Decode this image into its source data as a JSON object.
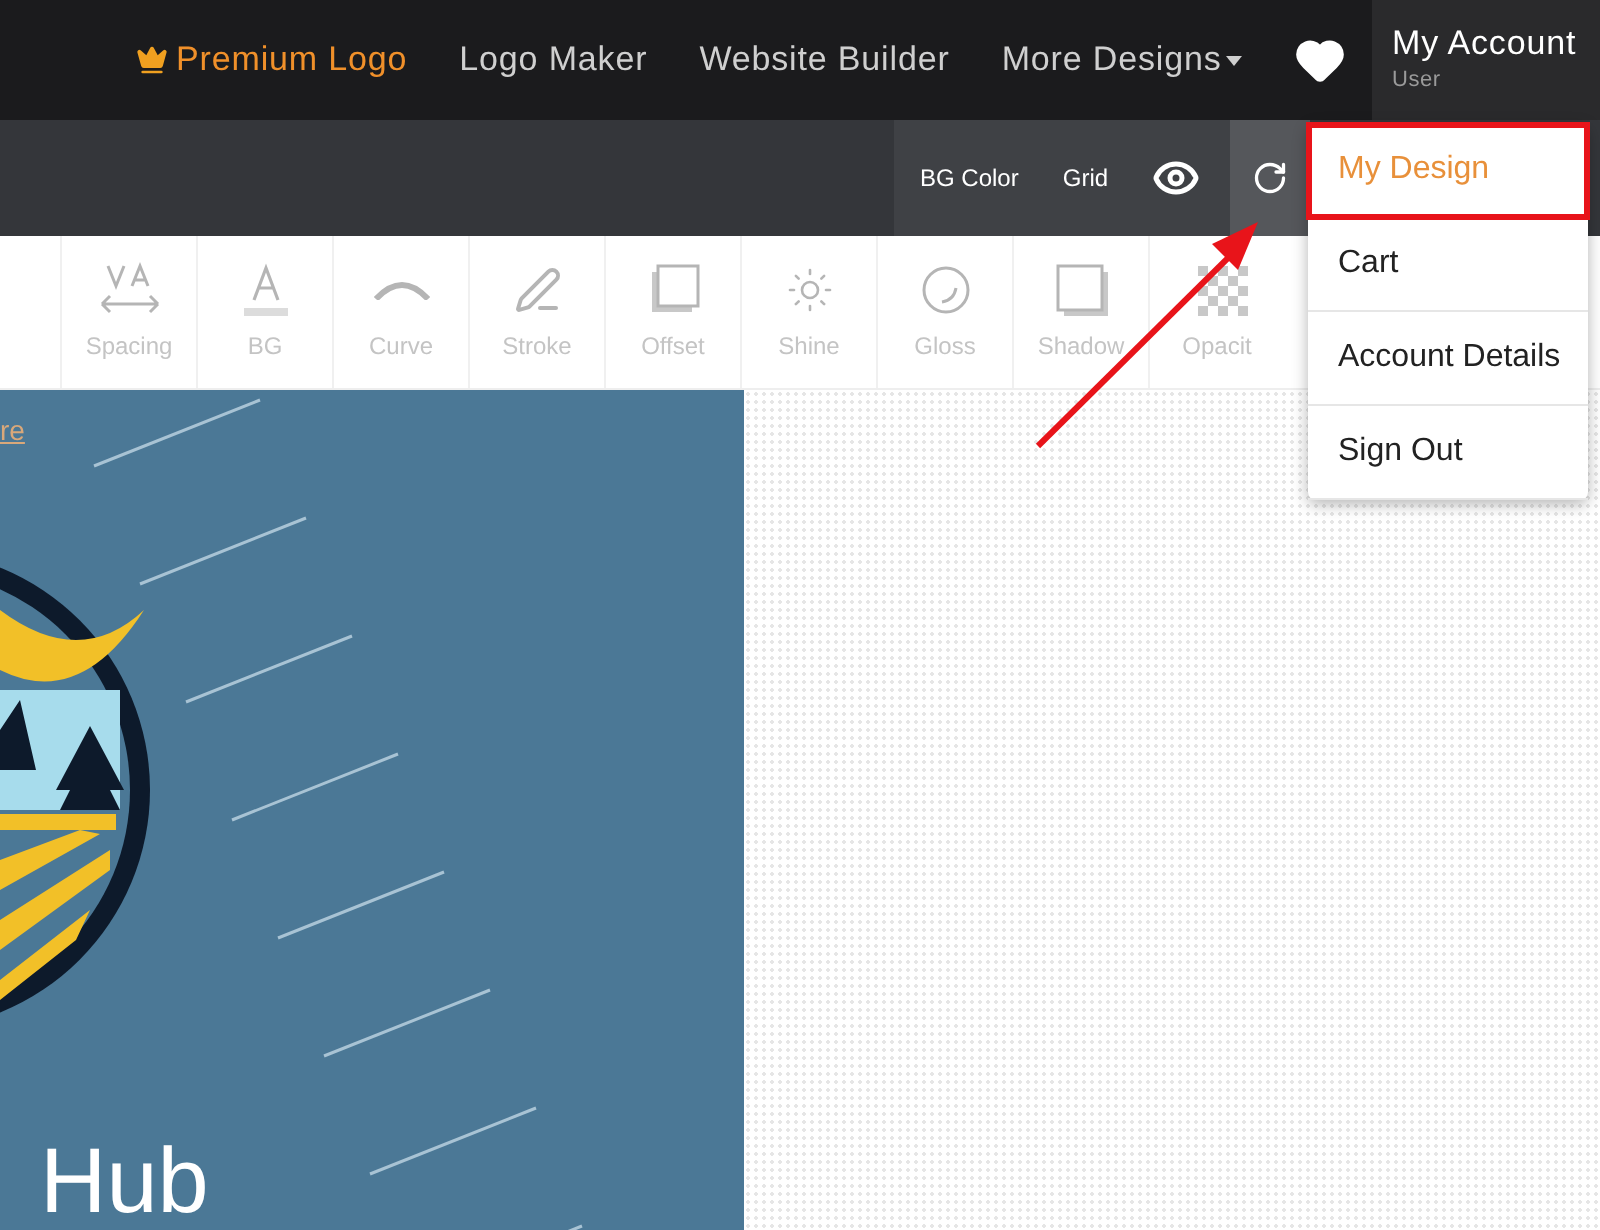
{
  "nav": {
    "items": [
      {
        "label": "Premium Logo",
        "kind": "premium"
      },
      {
        "label": "Logo Maker",
        "kind": "link"
      },
      {
        "label": "Website Builder",
        "kind": "link"
      },
      {
        "label": "More Designs",
        "kind": "dropdown"
      }
    ],
    "account": {
      "title": "My Account",
      "subtitle": "User"
    }
  },
  "toolbar": {
    "buttons": [
      "BG Color",
      "Grid"
    ]
  },
  "tools": [
    "Spacing",
    "BG",
    "Curve",
    "Stroke",
    "Offset",
    "Shine",
    "Gloss",
    "Shadow",
    "Opacit"
  ],
  "canvas": {
    "link": "re",
    "logo_text": "Hub"
  },
  "account_menu": [
    {
      "label": "My Design",
      "selected": true
    },
    {
      "label": "Cart",
      "selected": false
    },
    {
      "label": "Account Details",
      "selected": false
    },
    {
      "label": "Sign Out",
      "selected": false
    }
  ]
}
